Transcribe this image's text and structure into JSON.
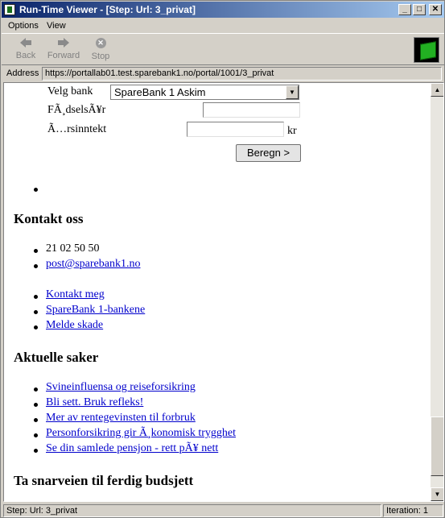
{
  "window": {
    "title": "Run-Time Viewer - [Step: Url: 3_privat]",
    "controls": {
      "minimize": "_",
      "maximize": "□",
      "close": "✕"
    }
  },
  "menubar": {
    "items": [
      "Options",
      "View"
    ]
  },
  "toolbar": {
    "back_label": "Back",
    "forward_label": "Forward",
    "stop_label": "Stop",
    "back_icon": "arrow-left-icon",
    "forward_icon": "arrow-right-icon",
    "stop_icon": "stop-icon"
  },
  "address": {
    "label": "Address",
    "url": "https://portallab01.test.sparebank1.no/portal/1001/3_privat"
  },
  "page": {
    "form": {
      "bank_label": "Velg bank",
      "bank_selected": "SpareBank 1 Askim",
      "birth_year_label": "FÃ¸dselsÃ¥r",
      "birth_year_value": "",
      "income_label": "Ã…rsinntekt",
      "income_value": "",
      "income_unit": "kr",
      "calculate_button": "Beregn >"
    },
    "contact": {
      "heading": "Kontakt oss",
      "phone": "21 02 50 50",
      "email": "post@sparebank1.no",
      "links": [
        "Kontakt meg",
        "SpareBank 1-bankene",
        "Melde skade"
      ]
    },
    "news": {
      "heading": "Aktuelle saker",
      "links": [
        "Svineinfluensa og reiseforsikring",
        "Bli sett. Bruk refleks!",
        "Mer av rentegevinsten til forbruk",
        "Personforsikring gir Ã¸konomisk trygghet",
        "Se din samlede pensjon - rett pÃ¥ nett"
      ]
    },
    "budget": {
      "heading": "Ta snarveien til ferdig budsjett"
    }
  },
  "statusbar": {
    "step": "Step: Url: 3_privat",
    "iteration": "Iteration: 1"
  },
  "colors": {
    "titlebar_start": "#0a246a",
    "titlebar_end": "#a6caf0",
    "link": "#0000cc",
    "chrome": "#d4d0c8"
  }
}
